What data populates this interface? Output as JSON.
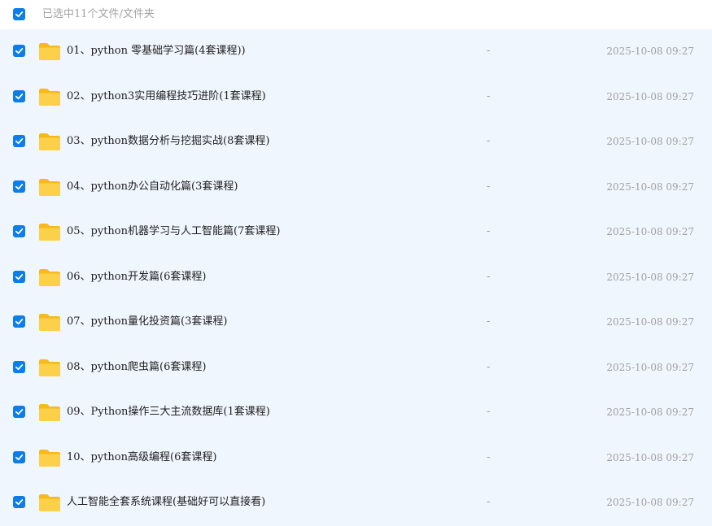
{
  "header": {
    "selection_label": "已选中11个文件/文件夹",
    "checked": true
  },
  "colors": {
    "accent": "#0c7dea",
    "list_background": "#f0f6fd",
    "folder_yellow": "#fcc52a"
  },
  "icons": {
    "checkbox": "checkbox-checked-icon",
    "folder": "folder-icon"
  },
  "files": [
    {
      "name": "01、python 零基础学习篇(4套课程))",
      "size": "-",
      "modified": "2025-10-08 09:27",
      "checked": true
    },
    {
      "name": "02、python3实用编程技巧进阶(1套课程)",
      "size": "-",
      "modified": "2025-10-08 09:27",
      "checked": true
    },
    {
      "name": "03、python数据分析与挖掘实战(8套课程)",
      "size": "-",
      "modified": "2025-10-08 09:27",
      "checked": true
    },
    {
      "name": "04、python办公自动化篇(3套课程)",
      "size": "-",
      "modified": "2025-10-08 09:27",
      "checked": true
    },
    {
      "name": "05、python机器学习与人工智能篇(7套课程)",
      "size": "-",
      "modified": "2025-10-08 09:27",
      "checked": true
    },
    {
      "name": "06、python开发篇(6套课程)",
      "size": "-",
      "modified": "2025-10-08 09:27",
      "checked": true
    },
    {
      "name": "07、python量化投资篇(3套课程)",
      "size": "-",
      "modified": "2025-10-08 09:27",
      "checked": true
    },
    {
      "name": "08、python爬虫篇(6套课程)",
      "size": "-",
      "modified": "2025-10-08 09:27",
      "checked": true
    },
    {
      "name": "09、Python操作三大主流数据库(1套课程)",
      "size": "-",
      "modified": "2025-10-08 09:27",
      "checked": true
    },
    {
      "name": "10、python高级编程(6套课程)",
      "size": "-",
      "modified": "2025-10-08 09:27",
      "checked": true
    },
    {
      "name": "人工智能全套系统课程(基础好可以直接看)",
      "size": "-",
      "modified": "2025-10-08 09:27",
      "checked": true
    }
  ]
}
